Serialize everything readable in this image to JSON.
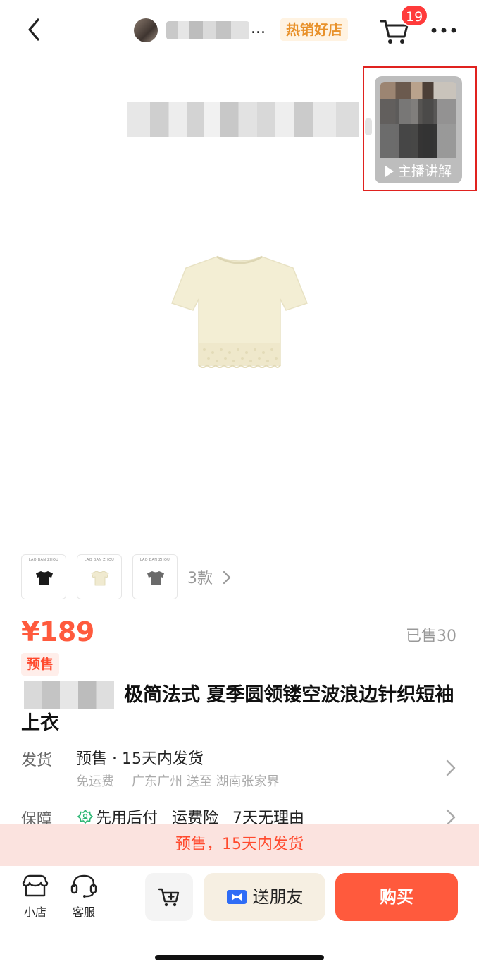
{
  "header": {
    "store_name_suffix": "...",
    "store_badge": "热销好店",
    "cart_count": "19",
    "icons": [
      "chevron-left-icon",
      "cart-icon",
      "more-icon"
    ]
  },
  "live": {
    "label": "主播讲解",
    "icon": "play-icon"
  },
  "variants": {
    "items": [
      {
        "brand": "LAO BAN ZHOU",
        "color": "#1a1a1a"
      },
      {
        "brand": "LAO BAN ZHOU",
        "color": "#f0ead0"
      },
      {
        "brand": "LAO BAN ZHOU",
        "color": "#6a6a6a"
      }
    ],
    "count_label": "3款"
  },
  "price": {
    "value": "¥189",
    "sold": "已售30",
    "presale_tag": "预售"
  },
  "product": {
    "title": "极简法式 夏季圆领镂空波浪边针织短袖上衣"
  },
  "shipping": {
    "label": "发货",
    "main": "预售 · 15天内发货",
    "free_shipping": "免运费",
    "route": "广东广州 送至 湖南张家界"
  },
  "guarantee": {
    "label": "保障",
    "items": [
      "先用后付",
      "运费险",
      "7天无理由"
    ]
  },
  "notice": "预售，15天内发货",
  "bottom": {
    "shop_label": "小店",
    "service_label": "客服",
    "gift_label": "送朋友",
    "buy_label": "购买"
  },
  "colors": {
    "accent": "#ff5a3d",
    "badge": "#e8912a",
    "notice_bg": "#fbe3df"
  }
}
